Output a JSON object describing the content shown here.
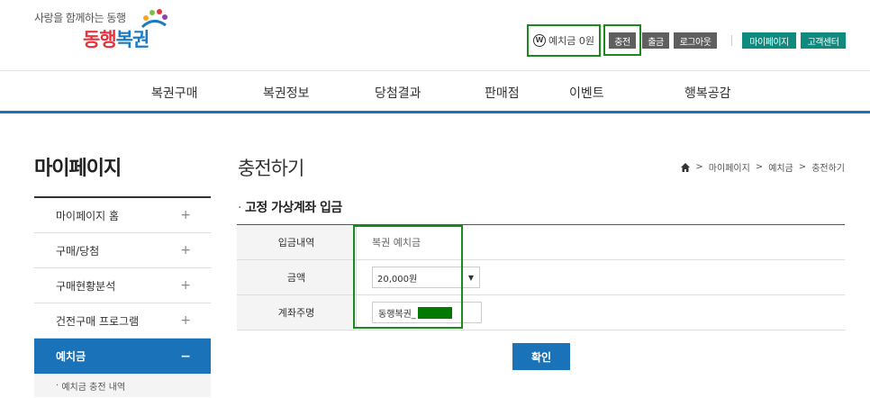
{
  "header": {
    "logo_sub": "사랑을 함께하는 동행",
    "logo_main_1": "동행",
    "logo_main_2": "복권",
    "deposit_icon": "W",
    "deposit_text": "예치금 0원",
    "buttons": {
      "charge": "충전",
      "withdraw": "출금",
      "logout": "로그아웃",
      "mypage": "마이페이지",
      "support": "고객센터"
    },
    "colors": {
      "gray_button": "#5f5f5f",
      "teal_button": "#0e8a7e",
      "highlight_box": "#1a8a1a"
    }
  },
  "nav": {
    "items": [
      "복권구매",
      "복권정보",
      "당첨결과",
      "판매점",
      "이벤트",
      "행복공감"
    ],
    "accent": "#1a73b8"
  },
  "sidebar": {
    "title": "마이페이지",
    "items": [
      {
        "label": "마이페이지 홈",
        "icon": "+"
      },
      {
        "label": "구매/당첨",
        "icon": "+"
      },
      {
        "label": "구매현황분석",
        "icon": "+"
      },
      {
        "label": "건전구매 프로그램",
        "icon": "+"
      },
      {
        "label": "예치금",
        "icon": "−"
      }
    ],
    "sub_item": "예치금 충전 내역"
  },
  "main": {
    "title": "충전하기",
    "breadcrumb": [
      "마이페이지",
      "예치금",
      "충전하기"
    ],
    "section_title": "고정 가상계좌 입금",
    "form": {
      "deposit_label": "입금내역",
      "deposit_value": "복권 예치금",
      "amount_label": "금액",
      "amount_value": "20,000원",
      "account_label": "계좌주명",
      "account_value": "동행복권_"
    },
    "confirm_label": "확인"
  }
}
